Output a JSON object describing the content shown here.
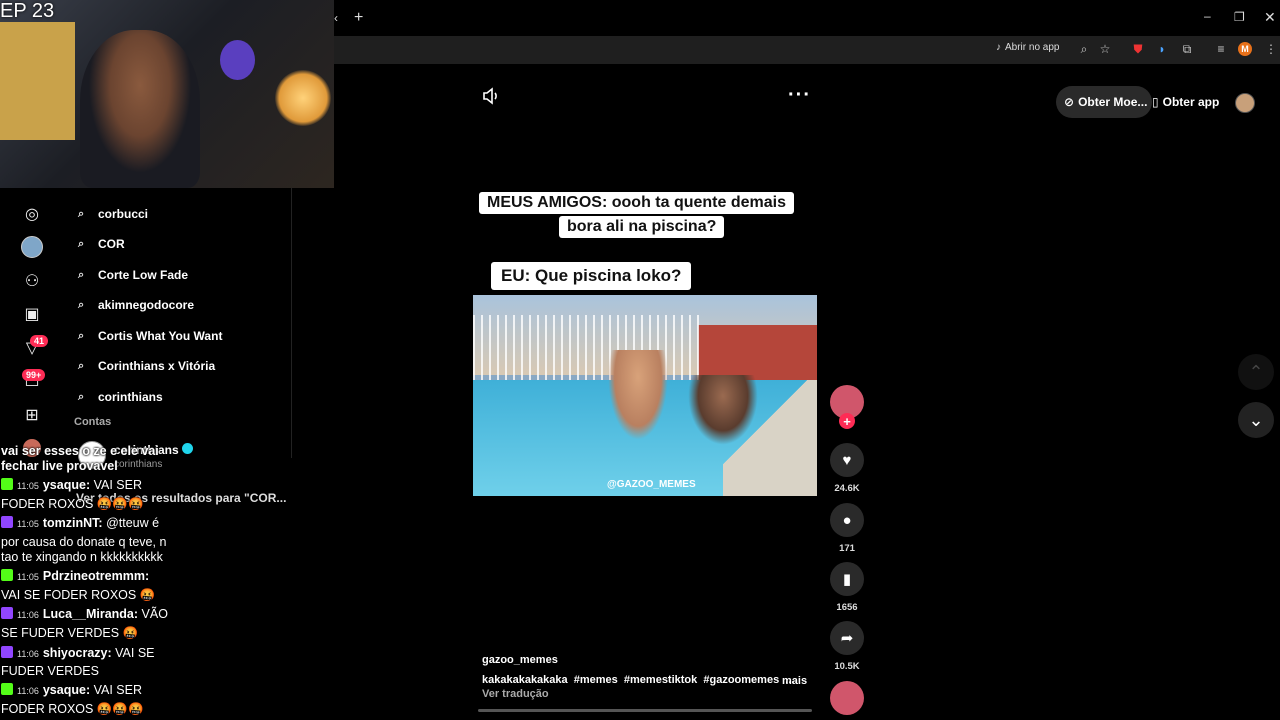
{
  "overlay": {
    "episode_label": "EP 23"
  },
  "browser": {
    "open_in_app_label": "Abrir no app",
    "profile_initial": "M"
  },
  "tiktok_header": {
    "get_coins_label": "Obter Moe...",
    "get_app_label": "Obter app"
  },
  "sidebar": {
    "notifications_badge": "41",
    "inbox_badge": "99+",
    "suggestions": [
      "corbucci",
      "COR",
      "Corte Low Fade",
      "akimnegodocore",
      "Cortis What You Want",
      "Corinthians x Vitória",
      "corinthians"
    ],
    "accounts_heading": "Contas",
    "account_name": "corinthians",
    "account_handle": "corinthians",
    "see_all_label": "Ver todos os resultados para \"COR..."
  },
  "chat": [
    {
      "platform": "kick",
      "time": "11:05",
      "user": "ysaque:",
      "lines": [
        "VAI SER",
        "FODER ROXOS 🤬🤬🤬"
      ],
      "prefix": "vai ser esses o ze e ele vai",
      "prefix2": "fechar live provavel"
    },
    {
      "platform": "twitch",
      "time": "11:05",
      "user": "tomzinNT:",
      "lines": [
        "@tteuw é",
        "por causa do donate q teve, n",
        "tao te xingando n kkkkkkkkkk"
      ]
    },
    {
      "platform": "kick",
      "time": "11:05",
      "user": "Pdrzineotremmm:",
      "lines": [
        "",
        "VAI SE FODER ROXOS 🤬"
      ]
    },
    {
      "platform": "twitch",
      "time": "11:06",
      "user": "Luca__Miranda:",
      "lines": [
        "VÃO",
        "SE FUDER VERDES 🤬"
      ]
    },
    {
      "platform": "twitch",
      "time": "11:06",
      "user": "shiyocrazy:",
      "lines": [
        "VAI SE",
        "FUDER VERDES"
      ]
    },
    {
      "platform": "kick",
      "time": "11:06",
      "user": "ysaque:",
      "lines": [
        "VAI SER",
        "FODER ROXOS 🤬🤬🤬"
      ]
    }
  ],
  "video": {
    "caption_top_line1": "MEUS AMIGOS: oooh ta quente demais",
    "caption_top_line2": "bora ali na piscina?",
    "caption_bottom": "EU: Que piscina loko?",
    "watermark": "@GAZOO_MEMES",
    "author": "gazoo_memes",
    "description": "kakakakakakaka  #memes  #memestiktok  #gazoomemes  ...",
    "more_label": "mais",
    "translate_label": "Ver tradução"
  },
  "actions": {
    "likes": "24.6K",
    "comments": "171",
    "saves": "1656",
    "shares": "10.5K"
  },
  "colors": {
    "accent": "#fe2c55",
    "kick": "#53fc18",
    "twitch": "#9146ff"
  }
}
